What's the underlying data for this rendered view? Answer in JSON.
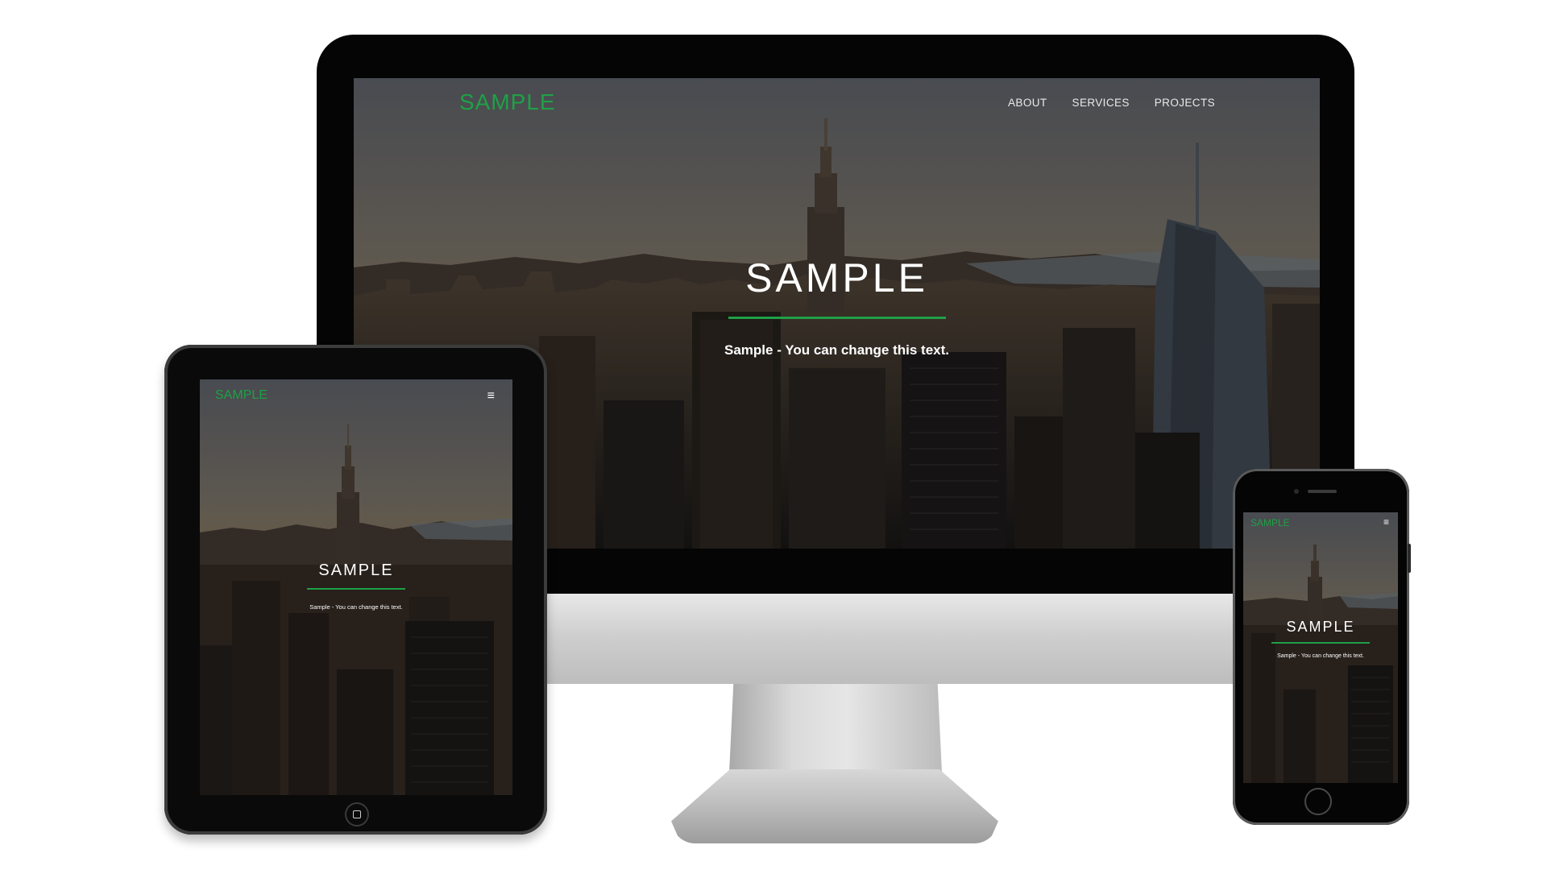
{
  "theme": {
    "accent": "#1fa046",
    "hero_text": "#ffffff"
  },
  "desktop": {
    "logo": "SAMPLE",
    "nav": [
      "ABOUT",
      "SERVICES",
      "PROJECTS"
    ],
    "hero_title": "SAMPLE",
    "hero_subtitle": "Sample - You can change this text."
  },
  "tablet": {
    "logo": "SAMPLE",
    "menu_icon": "hamburger-icon",
    "menu_glyph": "≡",
    "hero_title": "SAMPLE",
    "hero_subtitle": "Sample - You can change this text."
  },
  "phone": {
    "logo": "SAMPLE",
    "menu_icon": "hamburger-icon",
    "menu_glyph": "≡",
    "hero_title": "SAMPLE",
    "hero_subtitle": "Sample - You can change this text."
  }
}
